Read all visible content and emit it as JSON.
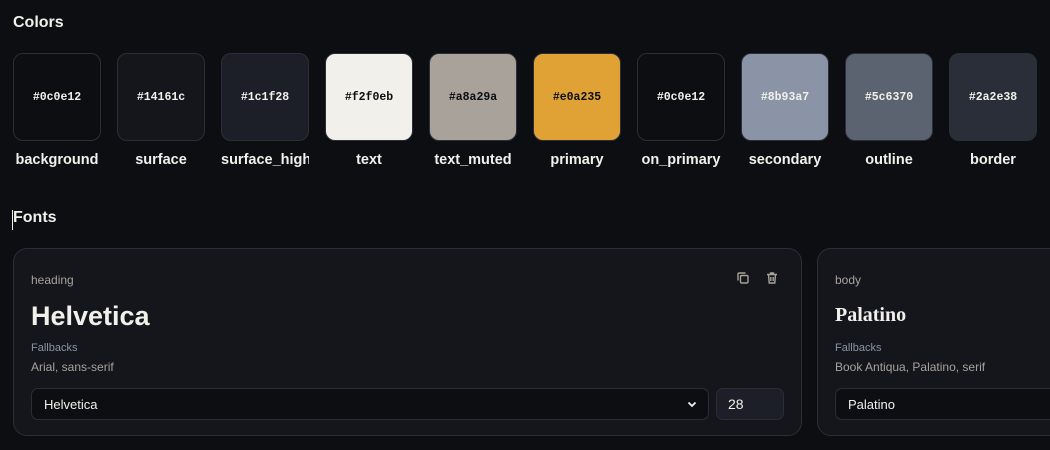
{
  "sections": {
    "colors_title": "Colors",
    "fonts_title": "Fonts"
  },
  "colors": [
    {
      "name": "background",
      "hex": "#0c0e12",
      "text_color": "#f2f0eb"
    },
    {
      "name": "surface",
      "hex": "#14161c",
      "text_color": "#f2f0eb"
    },
    {
      "name": "surface_high",
      "hex": "#1c1f28",
      "text_color": "#f2f0eb"
    },
    {
      "name": "text",
      "hex": "#f2f0eb",
      "text_color": "#0c0e12"
    },
    {
      "name": "text_muted",
      "hex": "#a8a29a",
      "text_color": "#0c0e12"
    },
    {
      "name": "primary",
      "hex": "#e0a235",
      "text_color": "#0c0e12"
    },
    {
      "name": "on_primary",
      "hex": "#0c0e12",
      "text_color": "#f2f0eb"
    },
    {
      "name": "secondary",
      "hex": "#8b93a7",
      "text_color": "#f2f0eb"
    },
    {
      "name": "outline",
      "hex": "#5c6370",
      "text_color": "#f2f0eb"
    },
    {
      "name": "border",
      "hex": "#2a2e38",
      "text_color": "#f2f0eb"
    }
  ],
  "fonts": {
    "heading": {
      "role": "heading",
      "family": "Helvetica",
      "fallbacks_label": "Fallbacks",
      "fallbacks": "Arial, sans-serif",
      "selected": "Helvetica",
      "size": "28",
      "icons": [
        "copy-icon",
        "trash-icon"
      ]
    },
    "body": {
      "role": "body",
      "family": "Palatino",
      "fallbacks_label": "Fallbacks",
      "fallbacks": "Book Antiqua, Palatino, serif",
      "selected": "Palatino"
    }
  }
}
